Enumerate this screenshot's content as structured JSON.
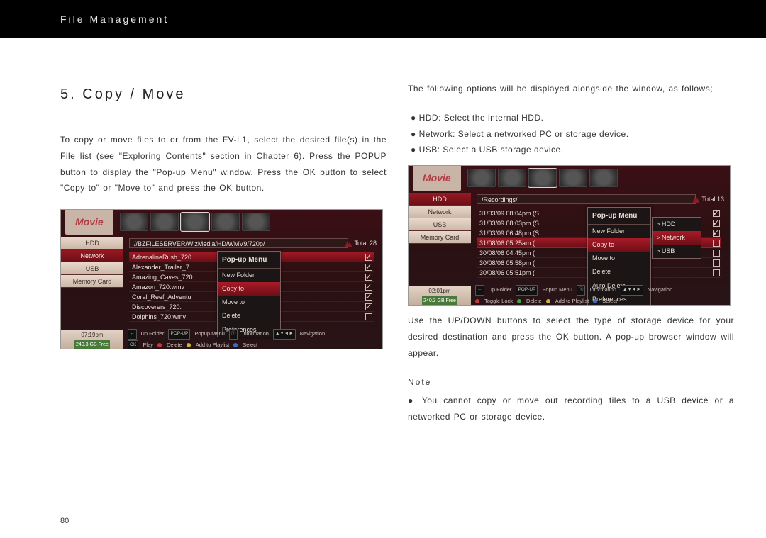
{
  "header": {
    "title": "File Management"
  },
  "section": {
    "num": "5.",
    "title": "Copy / Move"
  },
  "left": {
    "para1": "To copy or move files to or from the FV-L1, select the desired file(s) in the File list (see \"Exploring Contents\" section in Chapter 6).  Press the POPUP button to display the \"Pop-up Menu\" window.  Press the OK button to select \"Copy to\" or \"Move to\" and press the OK button."
  },
  "right": {
    "para1": "The following options will be displayed alongside the window, as follows;",
    "b1": "● HDD: Select the internal HDD.",
    "b2": "● Network: Select a networked PC or storage device.",
    "b3": "● USB: Select a USB storage device.",
    "para2": "Use the UP/DOWN buttons to select the type of storage device for your desired destination and press the OK button.  A pop-up browser window will appear.",
    "note_label": "Note",
    "note1": "● You cannot copy or move out recording files to a USB device or a networked PC or storage device."
  },
  "shot1": {
    "movie": "Movie",
    "side": [
      "HDD",
      "Network",
      "USB",
      "Memory Card"
    ],
    "side_sel": 1,
    "path": "//BZFILESERVER/WizMedia/HD/WMV9/720p/",
    "total": "Total 28",
    "files": [
      "AdrenalineRush_720.",
      "Alexander_Trailer_7",
      "Amazing_Caves_720.",
      "Amazon_720.wmv",
      "Coral_Reef_Adventu",
      "Discoverers_720.",
      "Dolphins_720.wmv"
    ],
    "file_sel": 0,
    "popup": {
      "title": "Pop-up Menu",
      "items": [
        "New Folder",
        "Copy to",
        "Move to",
        "Delete",
        "Preferences"
      ],
      "sel": 1
    },
    "time": "07:19pm",
    "free": "240.3 GB Free",
    "btm1": [
      "Up Folder",
      "Popup Menu",
      "Information",
      "Navigation"
    ],
    "btm2": [
      "Play",
      "Delete",
      "Add to Playlist",
      "Select"
    ]
  },
  "shot2": {
    "movie": "Movie",
    "side": [
      "HDD",
      "Network",
      "USB",
      "Memory Card"
    ],
    "side_sel": 0,
    "path": "/Recordings/",
    "total": "Total 13",
    "files": [
      "31/03/09 08:04pm (S",
      "31/03/09 08:03pm (S",
      "31/03/09 06:48pm (S",
      "31/08/06 05:25am (",
      "30/08/06 04:45pm (",
      "30/08/06 05:58pm (",
      "30/08/06 05:51pm ("
    ],
    "file_sel": 3,
    "popup": {
      "title": "Pop-up Menu",
      "items": [
        "New Folder",
        "Copy to",
        "Move to",
        "Delete",
        "Auto Delete",
        "Preferences"
      ],
      "sel": 1
    },
    "sub": {
      "items": [
        "HDD",
        "Network",
        "USB"
      ],
      "sel": 1
    },
    "time": "02:01pm",
    "free": "240.3 GB Free",
    "btm1": [
      "Up Folder",
      "Popup Menu",
      "Information",
      "Navigation"
    ],
    "btm2": [
      "Toggle Lock",
      "Delete",
      "Add to Playlist",
      "Select"
    ]
  },
  "page_number": "80"
}
